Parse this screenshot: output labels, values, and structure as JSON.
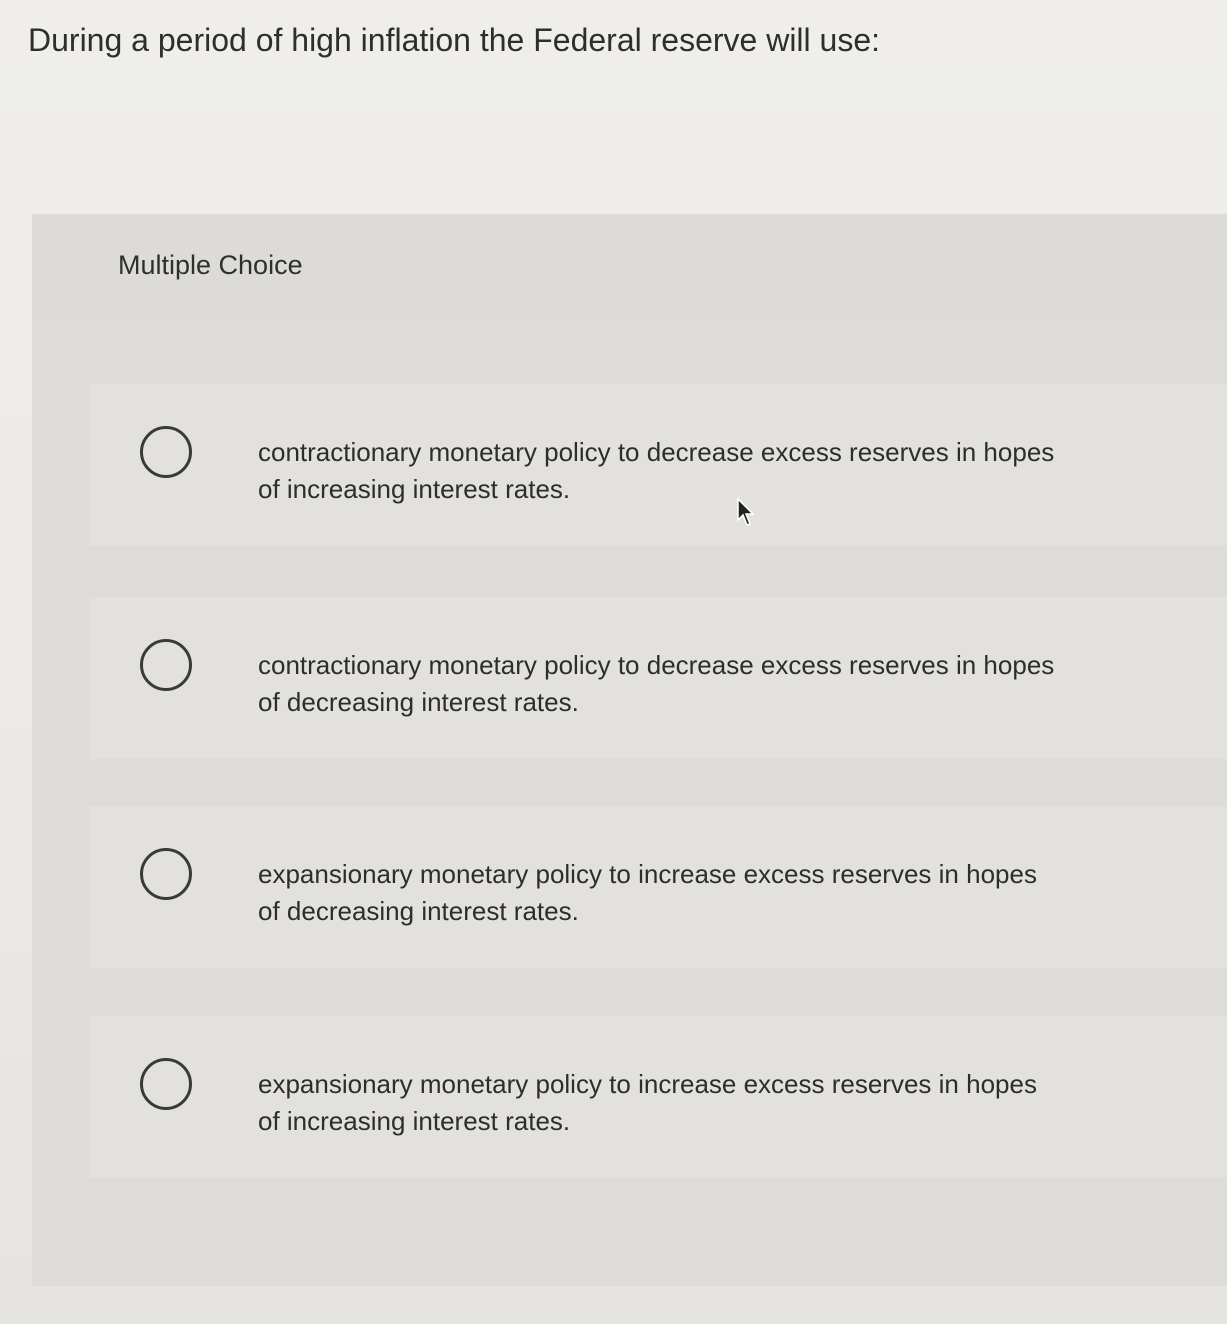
{
  "question": "During a period of high inflation the Federal reserve will use:",
  "section_label": "Multiple Choice",
  "choices": [
    {
      "label": "contractionary monetary policy to decrease excess reserves in hopes of increasing interest rates."
    },
    {
      "label": "contractionary monetary policy to decrease excess reserves in hopes of decreasing interest rates."
    },
    {
      "label": "expansionary monetary policy to increase excess reserves in hopes of decreasing interest rates."
    },
    {
      "label": "expansionary monetary policy to increase excess reserves in hopes of increasing interest rates."
    }
  ],
  "icons": {
    "radio": "radio-unchecked-icon",
    "cursor": "mouse-pointer-icon"
  }
}
